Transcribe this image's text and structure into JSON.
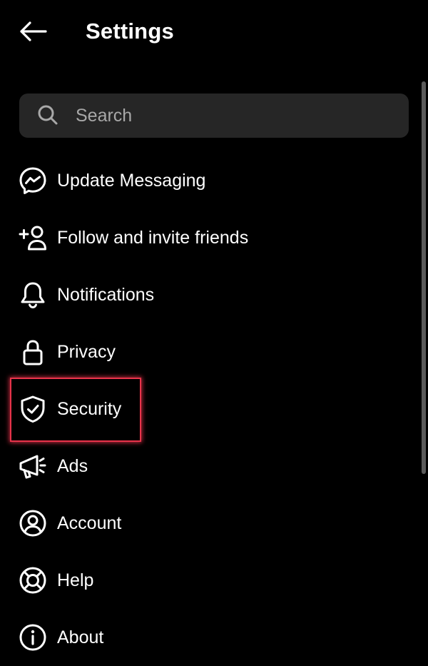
{
  "header": {
    "title": "Settings",
    "back_icon": "arrow-left-icon"
  },
  "search": {
    "placeholder": "Search",
    "icon": "search-icon"
  },
  "menu": {
    "items": [
      {
        "label": "Update Messaging",
        "icon": "messenger-icon"
      },
      {
        "label": "Follow and invite friends",
        "icon": "add-person-icon"
      },
      {
        "label": "Notifications",
        "icon": "bell-icon"
      },
      {
        "label": "Privacy",
        "icon": "lock-icon"
      },
      {
        "label": "Security",
        "icon": "shield-check-icon"
      },
      {
        "label": "Ads",
        "icon": "megaphone-icon"
      },
      {
        "label": "Account",
        "icon": "user-circle-icon"
      },
      {
        "label": "Help",
        "icon": "lifebuoy-icon"
      },
      {
        "label": "About",
        "icon": "info-icon"
      }
    ]
  },
  "highlight": {
    "target": "Security",
    "color": "#e8334a"
  },
  "colors": {
    "background": "#000000",
    "search_background": "#262626",
    "text": "#ffffff",
    "placeholder": "#a8a8a8"
  }
}
